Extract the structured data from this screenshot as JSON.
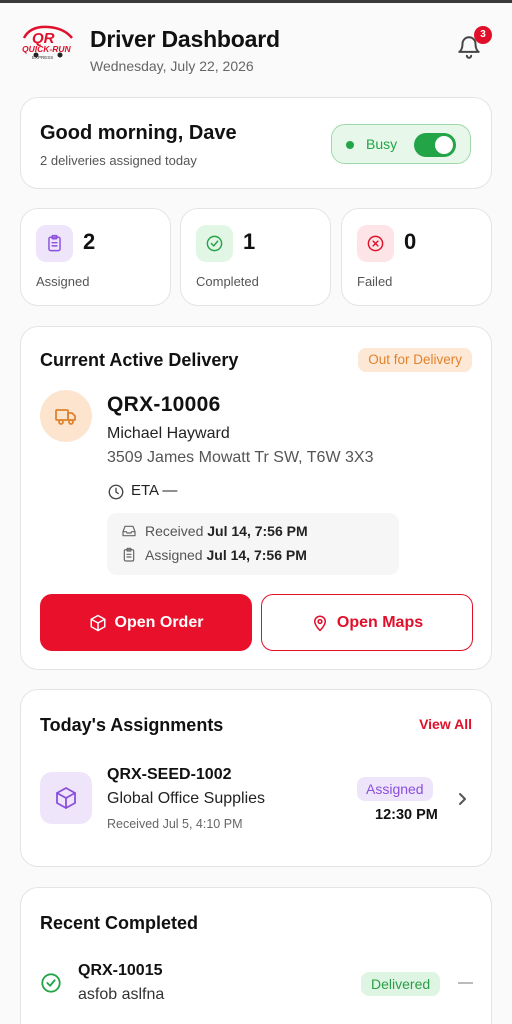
{
  "header": {
    "title": "Driver Dashboard",
    "date": "Wednesday, July 22, 2026",
    "notification_count": "3",
    "logo_text": "QUICK-RUN EXPRESS"
  },
  "greeting": {
    "title": "Good morning, Dave",
    "subtitle": "2 deliveries assigned today",
    "status_label": "Busy",
    "status_on": true
  },
  "stats": [
    {
      "value": "2",
      "label": "Assigned",
      "icon": "clipboard-icon",
      "color": "#8a4fdc"
    },
    {
      "value": "1",
      "label": "Completed",
      "icon": "check-circle-icon",
      "color": "#22a447"
    },
    {
      "value": "0",
      "label": "Failed",
      "icon": "x-circle-icon",
      "color": "#e0102a"
    }
  ],
  "active_delivery": {
    "section_title": "Current Active Delivery",
    "status": "Out for Delivery",
    "order_id": "QRX-10006",
    "customer": "Michael Hayward",
    "address": "3509 James Mowatt Tr SW, T6W 3X3",
    "eta": "ETA —",
    "received_label": "Received",
    "received_value": "Jul 14, 7:56 PM",
    "assigned_label": "Assigned",
    "assigned_value": "Jul 14, 7:56 PM",
    "open_order_label": "Open Order",
    "open_maps_label": "Open Maps"
  },
  "assignments": {
    "section_title": "Today's Assignments",
    "view_all": "View All",
    "items": [
      {
        "order_id": "QRX-SEED-1002",
        "name": "Global Office Supplies",
        "received": "Received Jul 5, 4:10 PM",
        "status": "Assigned",
        "time": "12:30 PM"
      }
    ]
  },
  "recent": {
    "section_title": "Recent Completed",
    "items": [
      {
        "order_id": "QRX-10015",
        "name": "asfob aslfna",
        "status": "Delivered",
        "trailing": "—"
      }
    ]
  },
  "colors": {
    "brand_red": "#e0102a",
    "success": "#22a447",
    "warning": "#e0832d",
    "purple": "#8a4fdc"
  }
}
